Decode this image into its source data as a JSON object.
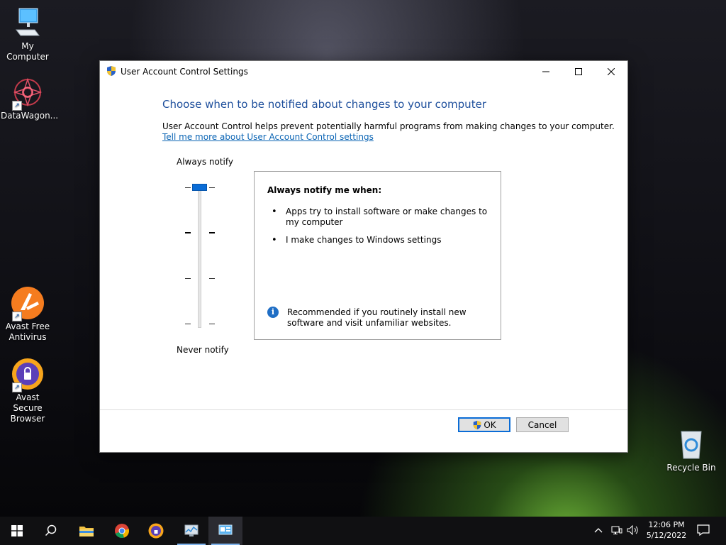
{
  "desktop": {
    "icons": [
      {
        "label": "My Computer"
      },
      {
        "label": "DataWagon..."
      },
      {
        "label": "Avast Free Antivirus"
      },
      {
        "label": "Avast Secure Browser"
      },
      {
        "label": "Recycle Bin"
      }
    ]
  },
  "dialog": {
    "title": "User Account Control Settings",
    "heading": "Choose when to be notified about changes to your computer",
    "description": "User Account Control helps prevent potentially harmful programs from making changes to your computer.",
    "link": "Tell me more about User Account Control settings",
    "slider": {
      "top_label": "Always notify",
      "bottom_label": "Never notify",
      "levels": 4,
      "selected_level": 4
    },
    "info": {
      "title": "Always notify me when:",
      "bullets": [
        "Apps try to install software or make changes to my computer",
        "I make changes to Windows settings"
      ],
      "recommendation": "Recommended if you routinely install new software and visit unfamiliar websites."
    },
    "buttons": {
      "ok": "OK",
      "cancel": "Cancel"
    }
  },
  "taskbar": {
    "apps": [
      "start-icon",
      "search-icon",
      "file-explorer-icon",
      "chrome-icon",
      "avast-browser-icon",
      "performance-monitor-icon",
      "uac-settings-icon"
    ],
    "time": "12:06 PM",
    "date": "5/12/2022"
  },
  "colors": {
    "accent": "#0a6cd6",
    "heading": "#1e4f9c",
    "link": "#0a64b4"
  }
}
